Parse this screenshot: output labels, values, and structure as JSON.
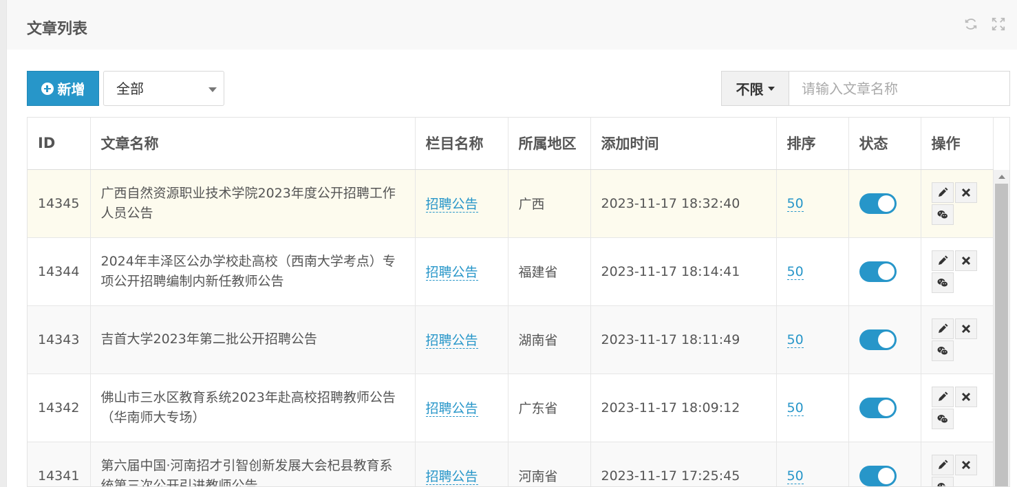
{
  "panel": {
    "title": "文章列表"
  },
  "toolbar": {
    "add_label": "新增",
    "category_select": "全部",
    "filter_label": "不限",
    "search_placeholder": "请输入文章名称"
  },
  "table": {
    "headers": {
      "id": "ID",
      "name": "文章名称",
      "category": "栏目名称",
      "region": "所属地区",
      "time": "添加时间",
      "sort": "排序",
      "status": "状态",
      "ops": "操作"
    },
    "rows": [
      {
        "id": "14345",
        "name": "广西自然资源职业技术学院2023年度公开招聘工作人员公告",
        "category": "招聘公告",
        "region": "广西",
        "time": "2023-11-17 18:32:40",
        "sort": "50",
        "status_on": true
      },
      {
        "id": "14344",
        "name": "2024年丰泽区公办学校赴高校（西南大学考点）专项公开招聘编制内新任教师公告",
        "category": "招聘公告",
        "region": "福建省",
        "time": "2023-11-17 18:14:41",
        "sort": "50",
        "status_on": true
      },
      {
        "id": "14343",
        "name": "吉首大学2023年第二批公开招聘公告",
        "category": "招聘公告",
        "region": "湖南省",
        "time": "2023-11-17 18:11:49",
        "sort": "50",
        "status_on": true
      },
      {
        "id": "14342",
        "name": "佛山市三水区教育系统2023年赴高校招聘教师公告（华南师大专场）",
        "category": "招聘公告",
        "region": "广东省",
        "time": "2023-11-17 18:09:12",
        "sort": "50",
        "status_on": true
      },
      {
        "id": "14341",
        "name": "第六届中国·河南招才引智创新发展大会杞县教育系统第三次公开引进教师公告",
        "category": "招聘公告",
        "region": "河南省",
        "time": "2023-11-17 17:25:45",
        "sort": "50",
        "status_on": true
      }
    ]
  },
  "colors": {
    "accent": "#2796c9",
    "highlight_row": "#fdfbee"
  },
  "icons": {
    "refresh": "refresh-icon",
    "fullscreen": "fullscreen-icon",
    "edit": "pencil-icon",
    "delete": "close-icon",
    "wechat": "wechat-icon",
    "add": "plus-circle-icon"
  }
}
